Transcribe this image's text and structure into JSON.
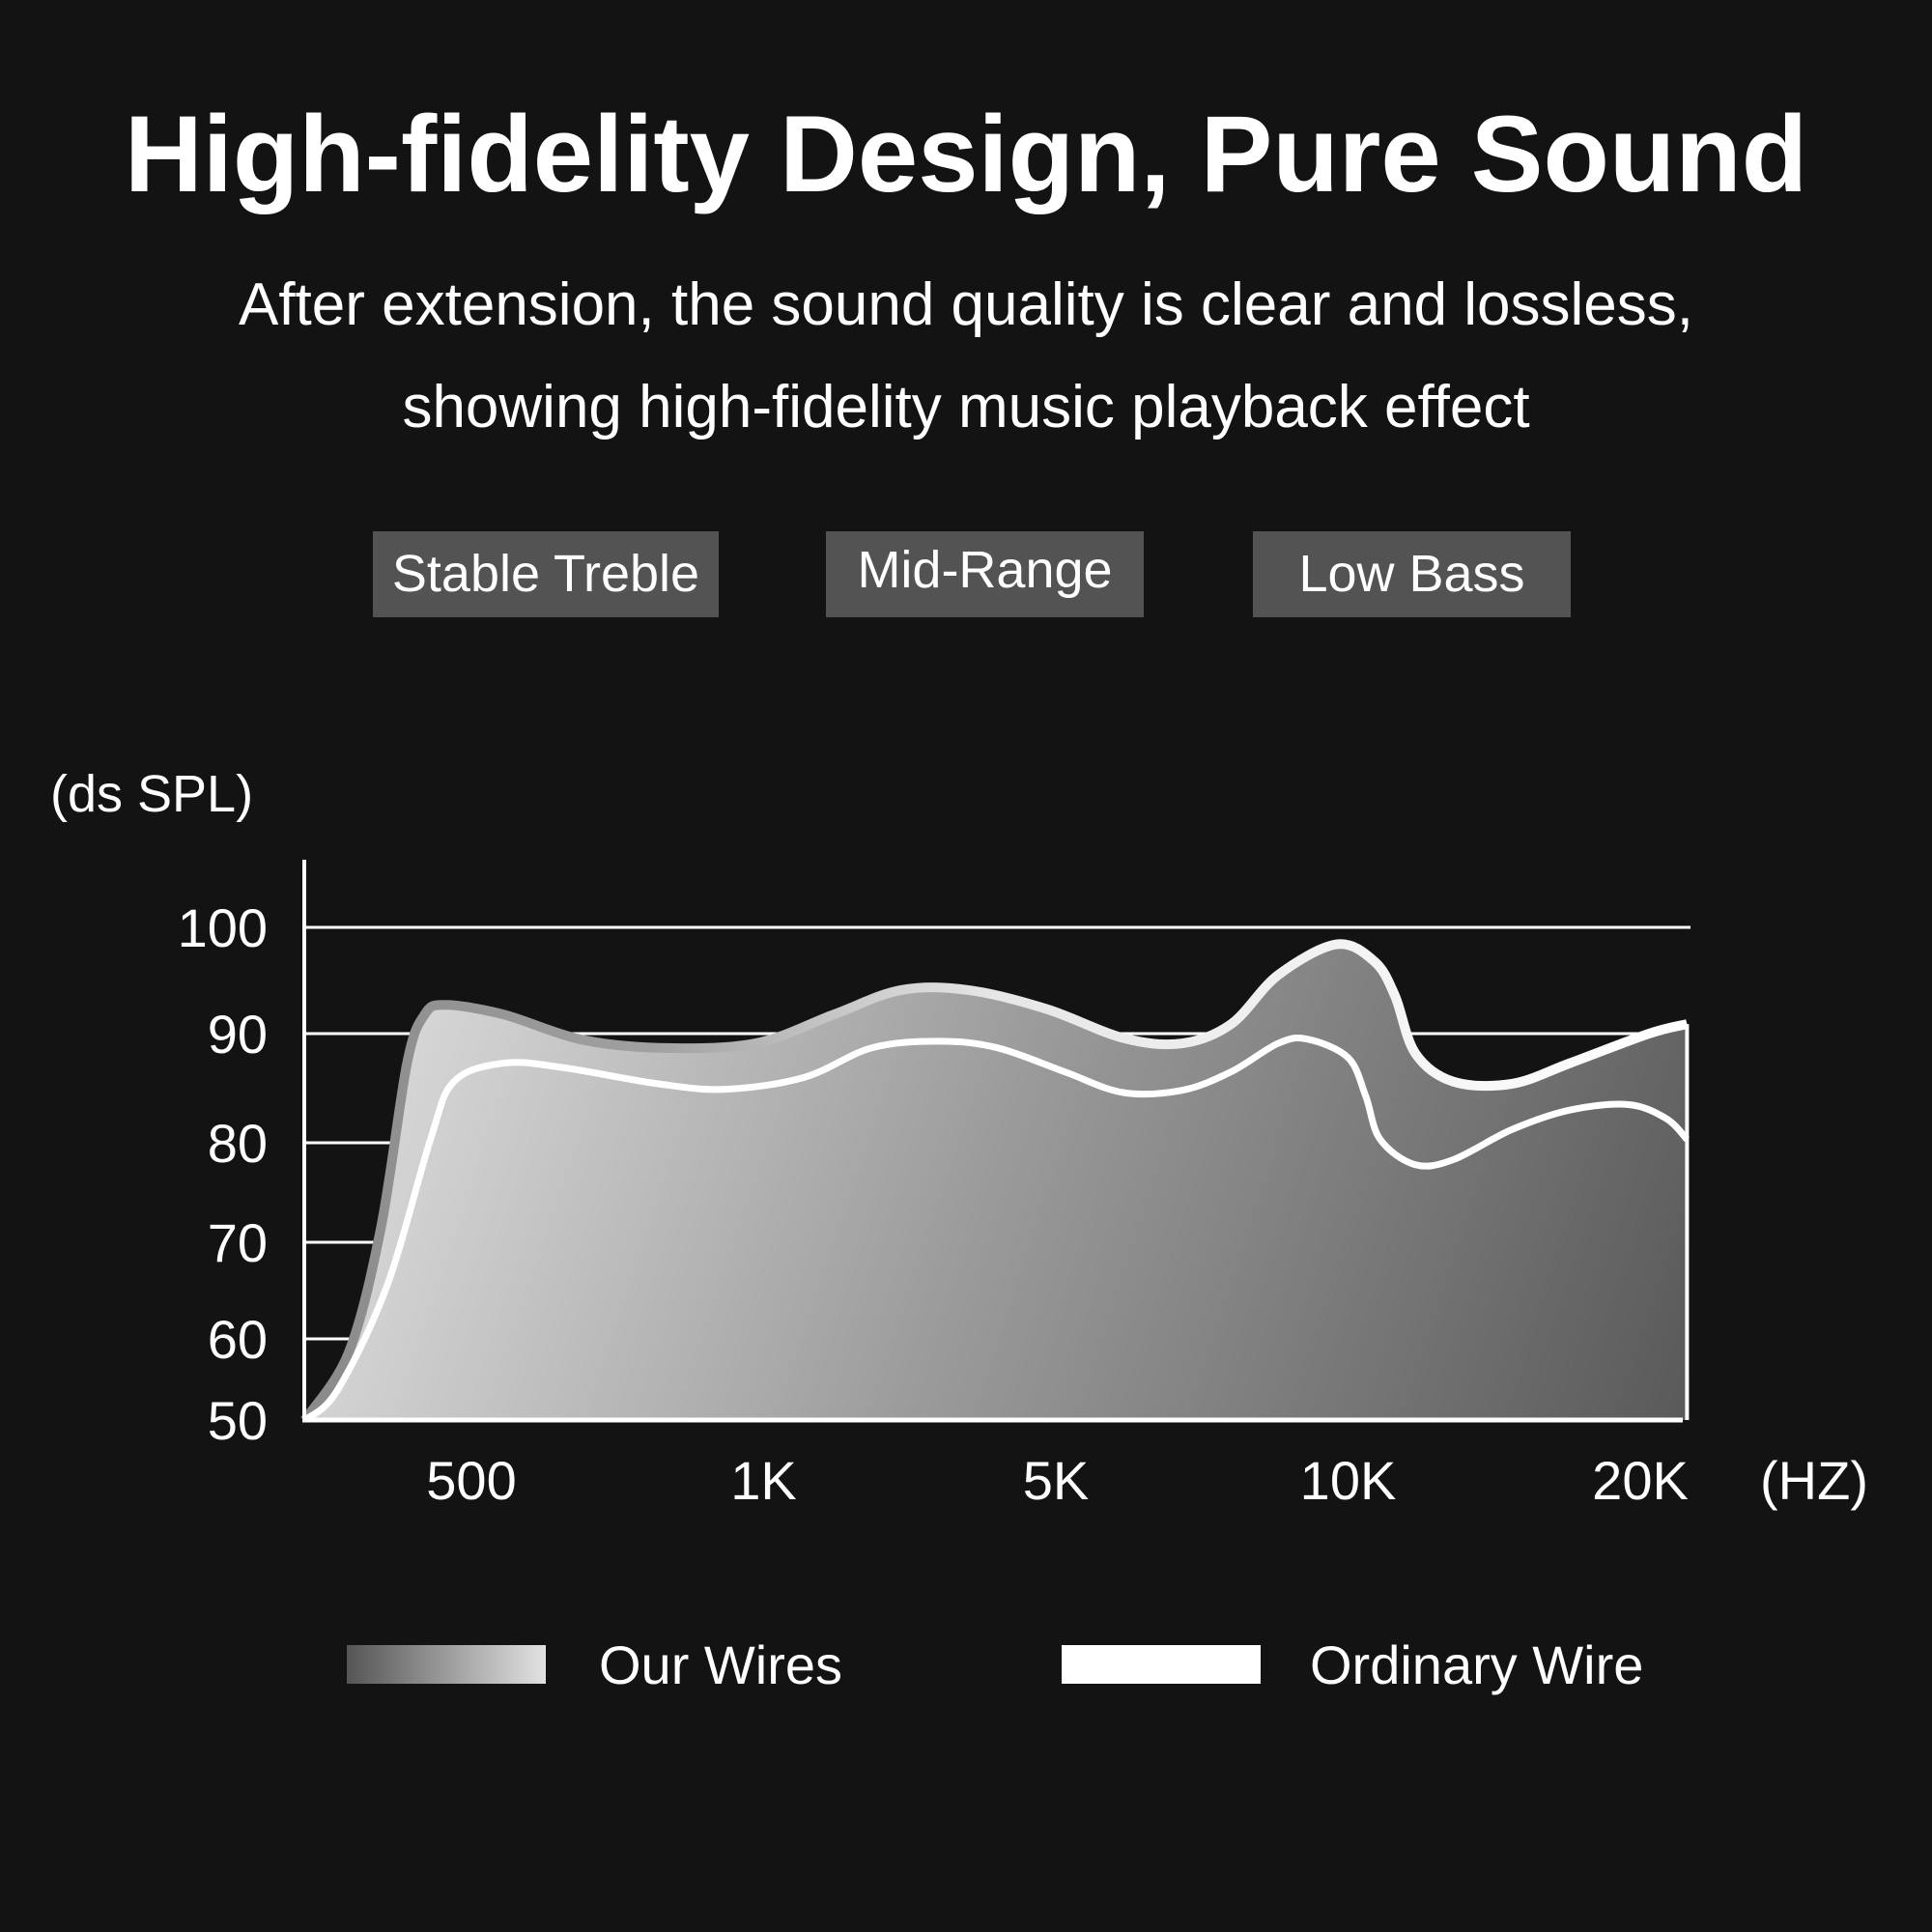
{
  "header": {
    "title": "High-fidelity Design, Pure Sound",
    "subtitle_line1": "After extension, the sound quality is clear and lossless,",
    "subtitle_line2": "showing high-fidelity music playback effect"
  },
  "tags": [
    {
      "label": "Stable Treble"
    },
    {
      "label": "Mid-Range"
    },
    {
      "label": "Low Bass"
    }
  ],
  "colors": {
    "background": "#131313",
    "tag_background": "#535353",
    "text": "#ffffff",
    "area_gradient_light": "#dcdcdc",
    "area_gradient_dark": "#5a5a5a",
    "ordinary_line": "#ffffff"
  },
  "chart_data": {
    "type": "area",
    "title": "",
    "ylabel": "(ds SPL)",
    "xlabel": "(HZ)",
    "y_ticks": [
      50,
      60,
      70,
      80,
      90,
      100
    ],
    "ylim": [
      50,
      100
    ],
    "categories": [
      "500",
      "1K",
      "5K",
      "10K",
      "20K"
    ],
    "x_axis_note": "x values are positions along the categorical frequency axis, in category-index units (500 = 0, 1K = 1, 5K = 2, 10K = 3, 20K = 4); axis starts at -0.57",
    "grid": true,
    "legend_position": "bottom",
    "series": [
      {
        "name": "Our Wires",
        "style": "gradient-filled area",
        "points": [
          [
            -0.57,
            50
          ],
          [
            -0.42,
            58.3
          ],
          [
            -0.31,
            71.4
          ],
          [
            -0.22,
            87.3
          ],
          [
            -0.16,
            91.8
          ],
          [
            -0.09,
            92.7
          ],
          [
            0.11,
            91.8
          ],
          [
            0.37,
            89.5
          ],
          [
            0.64,
            88.7
          ],
          [
            0.97,
            89.1
          ],
          [
            1.24,
            91.8
          ],
          [
            1.47,
            94.1
          ],
          [
            1.7,
            94.1
          ],
          [
            1.97,
            92.3
          ],
          [
            2.23,
            89.6
          ],
          [
            2.43,
            89.1
          ],
          [
            2.6,
            90.9
          ],
          [
            2.76,
            95.5
          ],
          [
            2.96,
            98.4
          ],
          [
            3.09,
            96.8
          ],
          [
            3.16,
            93.6
          ],
          [
            3.23,
            88.2
          ],
          [
            3.36,
            85.6
          ],
          [
            3.56,
            85.4
          ],
          [
            3.76,
            87.3
          ],
          [
            4.03,
            90.0
          ],
          [
            4.16,
            90.9
          ]
        ]
      },
      {
        "name": "Ordinary Wire",
        "style": "white line",
        "points": [
          [
            -0.57,
            50
          ],
          [
            -0.46,
            53.6
          ],
          [
            -0.29,
            65.4
          ],
          [
            -0.14,
            80.3
          ],
          [
            -0.06,
            85.6
          ],
          [
            0.11,
            87.3
          ],
          [
            0.31,
            86.9
          ],
          [
            0.64,
            85.4
          ],
          [
            0.87,
            84.9
          ],
          [
            1.14,
            86.0
          ],
          [
            1.37,
            88.7
          ],
          [
            1.6,
            89.3
          ],
          [
            1.8,
            88.7
          ],
          [
            2.03,
            86.5
          ],
          [
            2.23,
            84.6
          ],
          [
            2.43,
            84.8
          ],
          [
            2.6,
            86.5
          ],
          [
            2.76,
            89.1
          ],
          [
            2.86,
            89.5
          ],
          [
            3.0,
            87.8
          ],
          [
            3.06,
            84.3
          ],
          [
            3.11,
            80.3
          ],
          [
            3.23,
            77.8
          ],
          [
            3.36,
            78.3
          ],
          [
            3.56,
            81.2
          ],
          [
            3.76,
            83.0
          ],
          [
            3.96,
            83.5
          ],
          [
            4.09,
            82.2
          ],
          [
            4.16,
            80.3
          ]
        ]
      }
    ]
  },
  "legend": [
    {
      "label": "Our Wires",
      "swatch": "gradient"
    },
    {
      "label": "Ordinary Wire",
      "swatch": "white"
    }
  ]
}
